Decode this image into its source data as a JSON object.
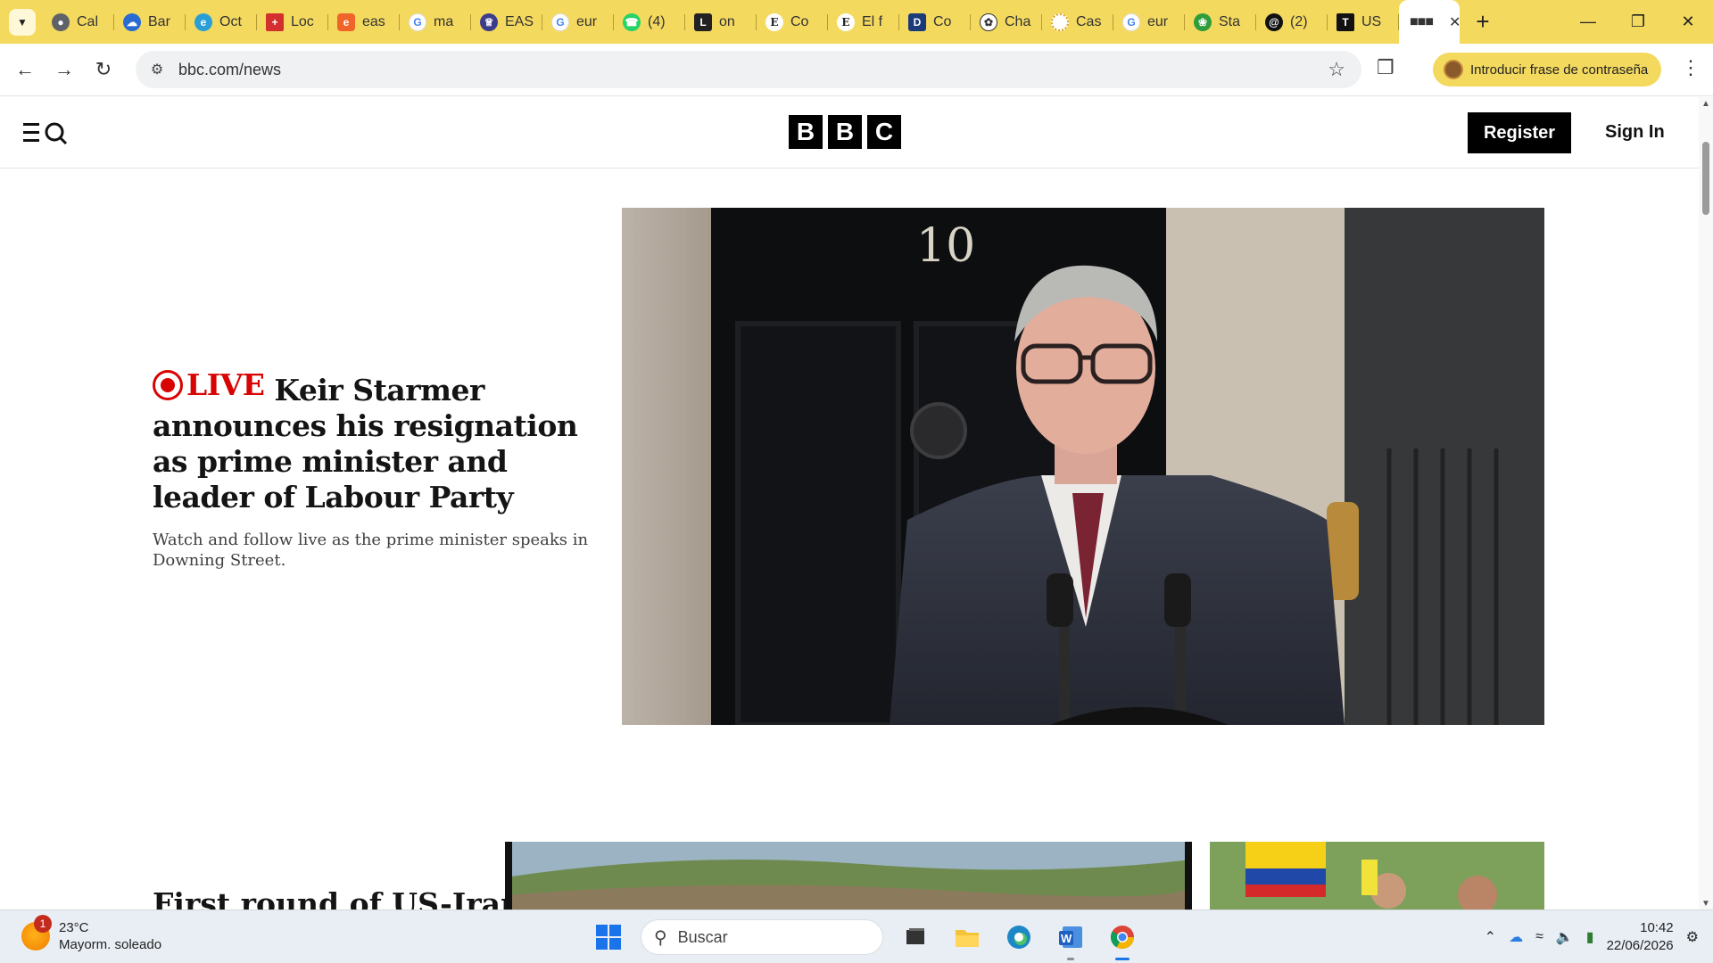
{
  "browser": {
    "tabs": [
      {
        "title": "Cal",
        "icon": "globe-icon",
        "color": "#5f6368"
      },
      {
        "title": "Bar",
        "icon": "cloud-app-icon",
        "color": "#2a6bd1"
      },
      {
        "title": "Oct",
        "icon": "edge-icon",
        "color": "#2a9fd6"
      },
      {
        "title": "Loc",
        "icon": "red-cross-icon",
        "color": "#d32f2f"
      },
      {
        "title": "eas",
        "icon": "orange-e-icon",
        "color": "#f0642a"
      },
      {
        "title": "ma",
        "icon": "google-icon",
        "color": "#4285f4"
      },
      {
        "title": "EAS",
        "icon": "crest-icon",
        "color": "#3c3c8c"
      },
      {
        "title": "eur",
        "icon": "google-icon",
        "color": "#4285f4"
      },
      {
        "title": "(4)",
        "icon": "whatsapp-icon",
        "color": "#25d366"
      },
      {
        "title": "on",
        "icon": "l-icon",
        "color": "#222222"
      },
      {
        "title": "Co",
        "icon": "e-serif-icon",
        "color": "#222222"
      },
      {
        "title": "El f",
        "icon": "e-serif-icon",
        "color": "#222222"
      },
      {
        "title": "Co",
        "icon": "d-icon",
        "color": "#1a3a7a"
      },
      {
        "title": "Cha",
        "icon": "openai-icon",
        "color": "#333333"
      },
      {
        "title": "Cas",
        "icon": "sun-dots-icon",
        "color": "#e0a020"
      },
      {
        "title": "eur",
        "icon": "google-icon",
        "color": "#4285f4"
      },
      {
        "title": "Sta",
        "icon": "green-leaf-icon",
        "color": "#2e9d3c"
      },
      {
        "title": "(2)",
        "icon": "threads-icon",
        "color": "#111111"
      },
      {
        "title": "US",
        "icon": "t-icon",
        "color": "#111111"
      }
    ],
    "active_tab": {
      "icon": "bbc-dots-icon"
    },
    "url": "bbc.com/news",
    "password_prompt": "Introducir frase de contraseña"
  },
  "bbc": {
    "logo_letters": [
      "B",
      "B",
      "C"
    ],
    "register_label": "Register",
    "signin_label": "Sign In",
    "lead": {
      "live_label": "LIVE",
      "headline": "Keir Starmer announces his resignation as prime minister and leader of Labour Party",
      "summary": "Watch and follow live as the prime minister speaks in Downing Street.",
      "door_number": "10"
    },
    "second_headline": "First round of US-Iran"
  },
  "taskbar": {
    "weather_temp": "23°C",
    "weather_desc": "Mayorm. soleado",
    "weather_badge": "1",
    "search_placeholder": "Buscar",
    "time": "10:42",
    "date": "22/06/2026"
  },
  "colors": {
    "chrome_frame": "#f4d95f",
    "bbc_live_red": "#d80303",
    "taskbar_bg": "#e9eef5"
  }
}
